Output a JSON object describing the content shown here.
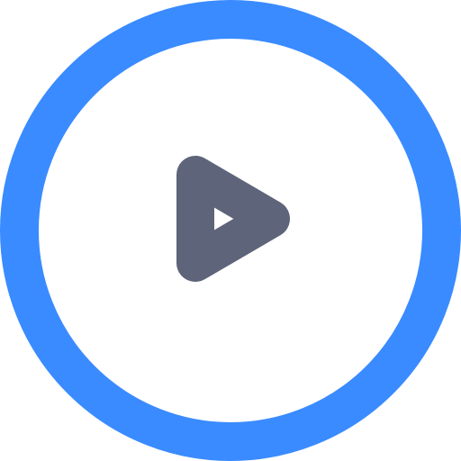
{
  "icon": {
    "name": "play-circle-icon",
    "colors": {
      "ring": "#3A8BFF",
      "triangle": "#5E6479",
      "background": "#FFFFFF"
    }
  }
}
